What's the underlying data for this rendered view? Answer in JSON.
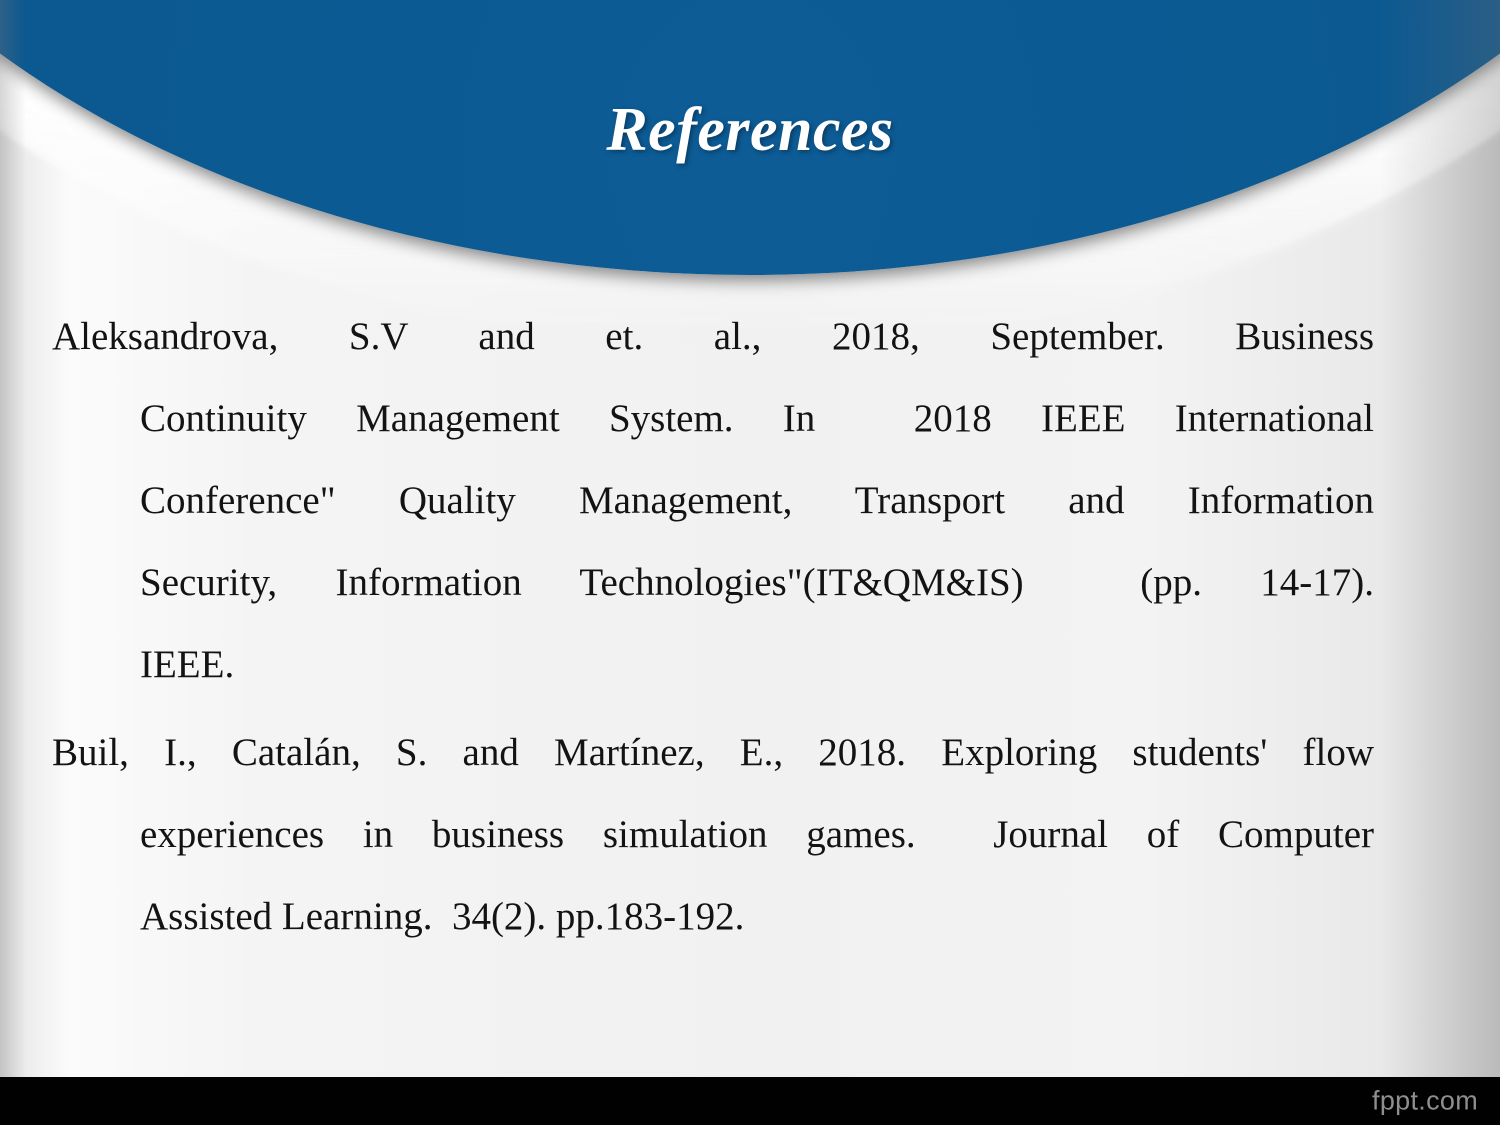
{
  "slide": {
    "title": "References",
    "theme": {
      "header_blue": "#0b5a92",
      "body_silver": "#f2f2f2",
      "title_color": "#ffffff",
      "text_color": "#131313",
      "footer_bar": "#010101",
      "watermark_color": "#8e8e8e"
    }
  },
  "references": [
    {
      "id": "reference-aleksandrova",
      "lines": [
        "Aleksandrova, S.V and et. al., 2018, September. Business",
        "Continuity Management System. In  2018 IEEE International",
        "Conference\" Quality Management, Transport and Information",
        "Security, Information Technologies\"(IT&QM&IS)  (pp. 14-17).",
        "IEEE."
      ],
      "full_text": "Aleksandrova, S.V and et. al., 2018, September. Business Continuity Management System. In  2018 IEEE International Conference\" Quality Management, Transport and Information Security, Information Technologies\"(IT&QM&IS)  (pp. 14-17). IEEE."
    },
    {
      "id": "reference-buil",
      "lines": [
        "Buil, I., Catalán, S. and Martínez, E., 2018. Exploring students' flow",
        "experiences in business simulation games.  Journal of Computer",
        "Assisted Learning.  34(2). pp.183-192."
      ],
      "full_text": "Buil, I., Catalán, S. and Martínez, E., 2018. Exploring students' flow experiences in business simulation games.  Journal of Computer Assisted Learning.  34(2). pp.183-192."
    }
  ],
  "footer": {
    "watermark": "fppt.com"
  }
}
